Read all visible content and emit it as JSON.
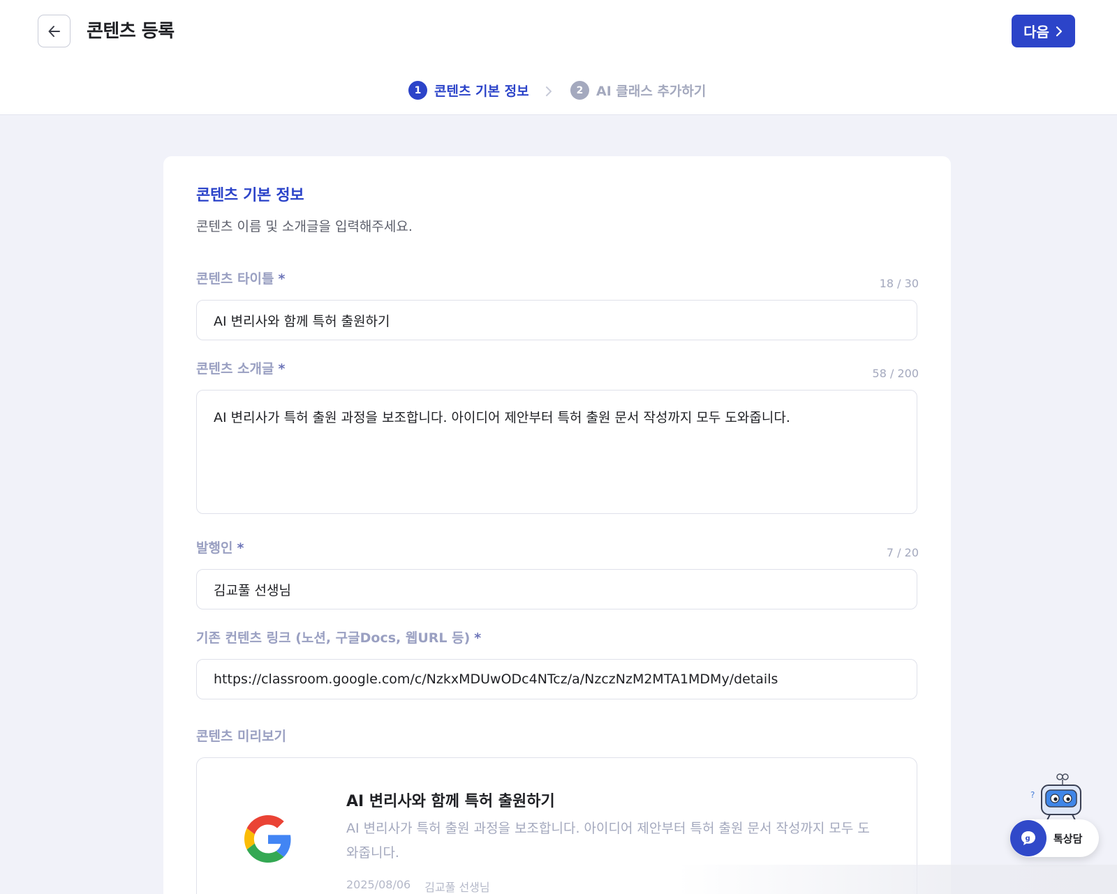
{
  "header": {
    "title": "콘텐츠 등록",
    "next_label": "다음"
  },
  "stepper": {
    "steps": [
      {
        "num": "1",
        "label": "콘텐츠 기본 정보"
      },
      {
        "num": "2",
        "label": "AI 클래스 추가하기"
      }
    ]
  },
  "section": {
    "title": "콘텐츠 기본 정보",
    "desc": "콘텐츠 이름 및 소개글을 입력해주세요."
  },
  "fields": {
    "title": {
      "label": "콘텐츠 타이틀",
      "required": "*",
      "counter": "18 / 30",
      "value": "AI 변리사와 함께 특허 출원하기"
    },
    "intro": {
      "label": "콘텐츠 소개글",
      "required": "*",
      "counter": "58 / 200",
      "value": "AI 변리사가 특허 출원 과정을 보조합니다. 아이디어 제안부터 특허 출원 문서 작성까지 모두 도와줍니다."
    },
    "publisher": {
      "label": "발행인",
      "required": "*",
      "counter": "7 / 20",
      "value": "김교풀 선생님"
    },
    "link": {
      "label": "기존 컨텐츠 링크 (노션, 구글Docs, 웹URL 등)",
      "required": "*",
      "value": "https://classroom.google.com/c/NzkxMDUwODc4NTcz/a/NzczNzM2MTA1MDMy/details"
    }
  },
  "preview": {
    "label": "콘텐츠 미리보기",
    "title": "AI 변리사와 함께 특허 출원하기",
    "desc": "AI 변리사가 특허 출원 과정을 보조합니다. 아이디어 제안부터 특허 출원 문서 작성까지 모두 도와줍니다.",
    "date": "2025/08/06",
    "author": "김교풀 선생님"
  },
  "chat": {
    "label": "톡상담"
  },
  "colors": {
    "primary": "#2c44c9",
    "muted": "#a4a9be",
    "background": "#f1f2f9"
  }
}
